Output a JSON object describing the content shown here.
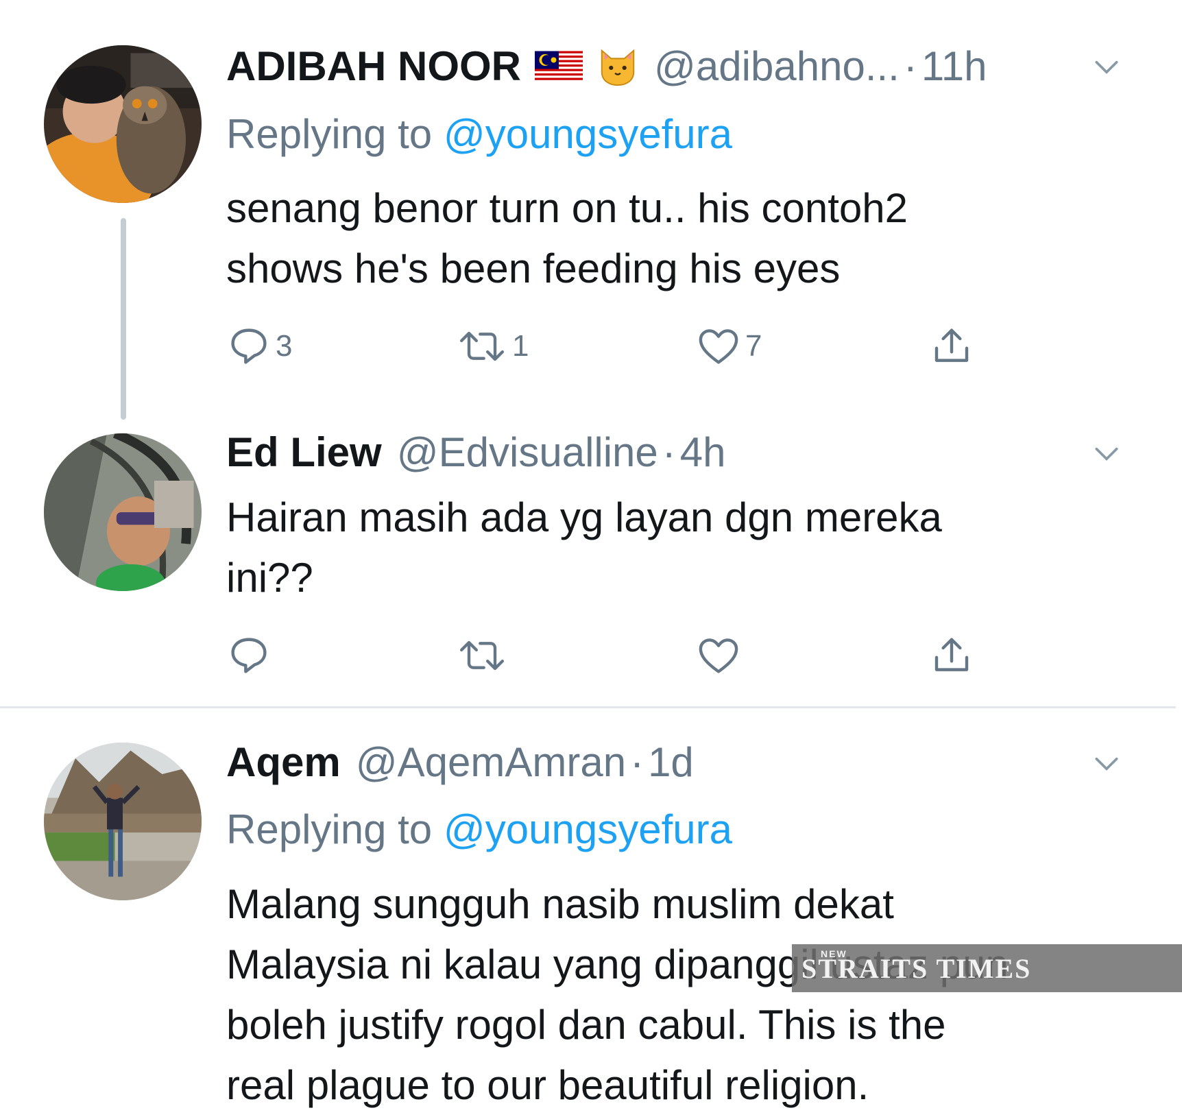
{
  "tweets": [
    {
      "display_name": "ADIBAH NOOR",
      "emojis": [
        "malaysia-flag",
        "cat-face"
      ],
      "handle": "@adibahno...",
      "dot": "·",
      "time": "11h",
      "replying_to_label": "Replying to",
      "replying_to_handle": "@youngsyefura",
      "text_lines": [
        "senang benor turn on tu.. his contoh2",
        "shows he's been feeding his eyes"
      ],
      "reply_count": "3",
      "retweet_count": "1",
      "like_count": "7"
    },
    {
      "display_name": "Ed Liew",
      "handle": "@Edvisualline",
      "dot": "·",
      "time": "4h",
      "text_lines": [
        "Hairan masih ada yg layan dgn mereka",
        "ini??"
      ],
      "reply_count": "",
      "retweet_count": "",
      "like_count": ""
    },
    {
      "display_name": "Aqem",
      "handle": "@AqemAmran",
      "dot": "·",
      "time": "1d",
      "replying_to_label": "Replying to",
      "replying_to_handle": "@youngsyefura",
      "text_lines": [
        "Malang sungguh nasib muslim dekat",
        "Malaysia ni kalau yang dipanggil ustaz pun",
        "boleh justify rogol dan cabul. This is the",
        "real plague to our beautiful religion."
      ]
    }
  ],
  "watermark": {
    "small": "NEW",
    "text": "STRAITS TIMES"
  },
  "colors": {
    "text": "#14171a",
    "secondary": "#657786",
    "link": "#1da1f2",
    "divider": "#e1e8ed",
    "thread_line": "#c4ccd4"
  },
  "icons": [
    "reply-icon",
    "retweet-icon",
    "like-icon",
    "share-icon",
    "chevron-down-icon"
  ]
}
